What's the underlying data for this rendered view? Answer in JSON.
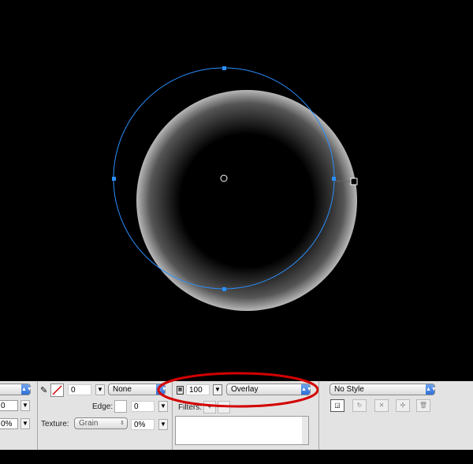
{
  "left_panel": {
    "field1": "0",
    "field2": "0%"
  },
  "stroke": {
    "size": "0",
    "edge_mode": "None",
    "edge_label": "Edge:",
    "edge_value": "0",
    "texture_label": "Texture:",
    "texture": "Grain",
    "texture_amount": "0%"
  },
  "effects": {
    "opacity": "100",
    "blend_mode": "Overlay",
    "filters_label": "Filters:"
  },
  "styles": {
    "style": "No Style"
  },
  "colors": {
    "selection": "#2a8fff",
    "annotation": "#d40000"
  }
}
